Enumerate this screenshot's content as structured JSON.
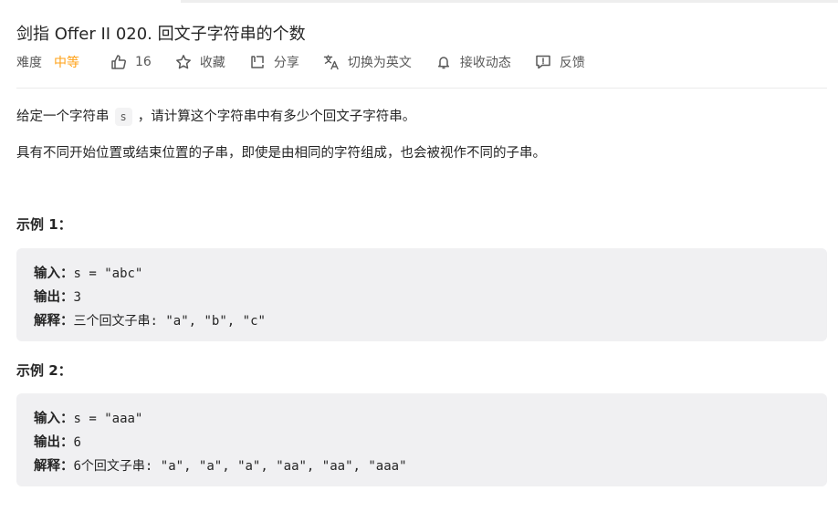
{
  "problem": {
    "title": "剑指 Offer II 020. 回文子字符串的个数"
  },
  "meta": {
    "difficulty_label": "难度",
    "difficulty_value": "中等",
    "likes": "16",
    "collect_label": "收藏",
    "share_label": "分享",
    "translate_label": "切换为英文",
    "subscribe_label": "接收动态",
    "feedback_label": "反馈",
    "colors": {
      "difficulty_medium": "#ffa116"
    }
  },
  "description": {
    "p1_before": "给定一个字符串",
    "p1_code": "s",
    "p1_after": "，请计算这个字符串中有多少个回文子字符串。",
    "p2": "具有不同开始位置或结束位置的子串，即使是由相同的字符组成，也会被视作不同的子串。"
  },
  "examples": [
    {
      "title": "示例 1：",
      "input_label": "输入：",
      "input_value": "s = \"abc\"",
      "output_label": "输出：",
      "output_value": "3",
      "explain_label": "解释：",
      "explain_value": "三个回文子串: \"a\", \"b\", \"c\""
    },
    {
      "title": "示例 2：",
      "input_label": "输入：",
      "input_value": "s = \"aaa\"",
      "output_label": "输出：",
      "output_value": "6",
      "explain_label": "解释：",
      "explain_value": "6个回文子串: \"a\", \"a\", \"a\", \"aa\", \"aa\", \"aaa\""
    }
  ]
}
